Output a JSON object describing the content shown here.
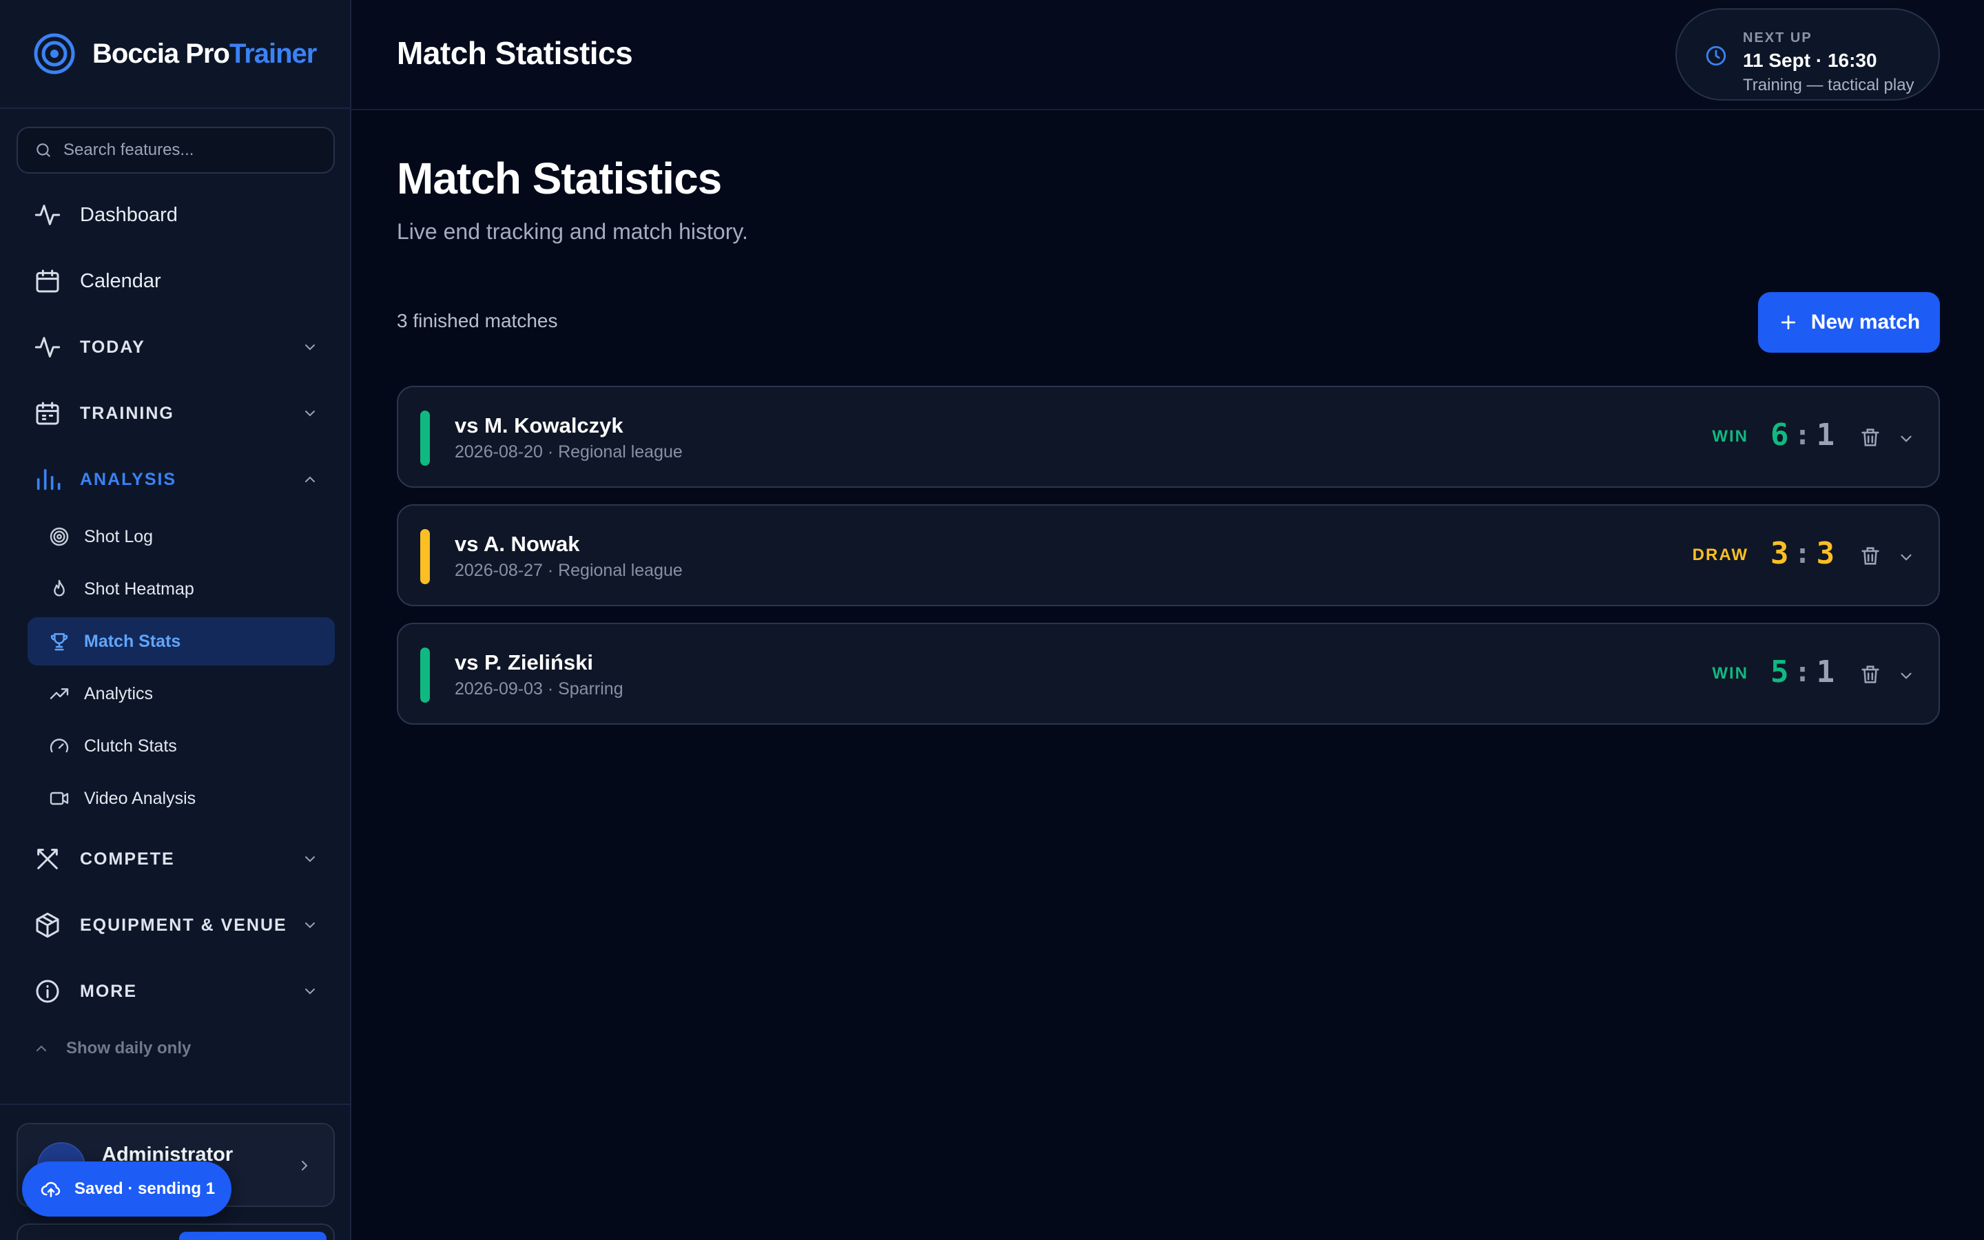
{
  "app": {
    "brand_main": "Boccia Pro",
    "brand_accent": "Trainer",
    "accent_color": "#3b82f6",
    "logo_icon": "target-icon"
  },
  "sidebar": {
    "search_placeholder": "Search features...",
    "items": [
      {
        "label": "Dashboard",
        "icon": "activity-icon"
      },
      {
        "label": "Calendar",
        "icon": "calendar-icon"
      },
      {
        "label": "TODAY",
        "icon": "pulse-icon",
        "expandable": true
      },
      {
        "label": "TRAINING",
        "icon": "calendar-check-icon",
        "expandable": true
      },
      {
        "label": "ANALYSIS",
        "icon": "bar-chart-icon",
        "expanded": true
      },
      {
        "label": "COMPETE",
        "icon": "swords-icon",
        "expandable": true
      },
      {
        "label": "EQUIPMENT & VENUE",
        "icon": "package-icon",
        "expandable": true
      },
      {
        "label": "MORE",
        "icon": "info-icon",
        "expandable": true
      }
    ],
    "analysis_sub": [
      {
        "label": "Shot Log",
        "icon": "target-icon"
      },
      {
        "label": "Shot Heatmap",
        "icon": "flame-icon"
      },
      {
        "label": "Match Stats",
        "icon": "trophy-icon",
        "selected": true
      },
      {
        "label": "Analytics",
        "icon": "trending-up-icon"
      },
      {
        "label": "Clutch Stats",
        "icon": "gauge-icon"
      },
      {
        "label": "Video Analysis",
        "icon": "video-icon"
      }
    ],
    "show_daily": "Show daily only",
    "user_name": "Administrator"
  },
  "toast": {
    "text": "Saved · sending 1",
    "icon": "cloud-upload-icon"
  },
  "topbar": {
    "title": "Match Statistics",
    "next_up_label": "NEXT UP",
    "next_up_time": "11 Sept · 16:30",
    "next_up_desc": "Training — tactical play"
  },
  "main": {
    "title": "Match Statistics",
    "subtitle": "Live end tracking and match history.",
    "count_text": "3 finished matches",
    "new_match_label": "New match",
    "matches": [
      {
        "opponent": "vs M. Kowalczyk",
        "meta": "2026-08-20 · Regional league",
        "result": "WIN",
        "score_own": "6",
        "score_opp": "1",
        "color": "#10b981"
      },
      {
        "opponent": "vs A. Nowak",
        "meta": "2026-08-27 · Regional league",
        "result": "DRAW",
        "score_own": "3",
        "score_opp": "3",
        "color": "#fbbf24"
      },
      {
        "opponent": "vs P. Zieliński",
        "meta": "2026-09-03 · Sparring",
        "result": "WIN",
        "score_own": "5",
        "score_opp": "1",
        "color": "#10b981"
      }
    ]
  }
}
